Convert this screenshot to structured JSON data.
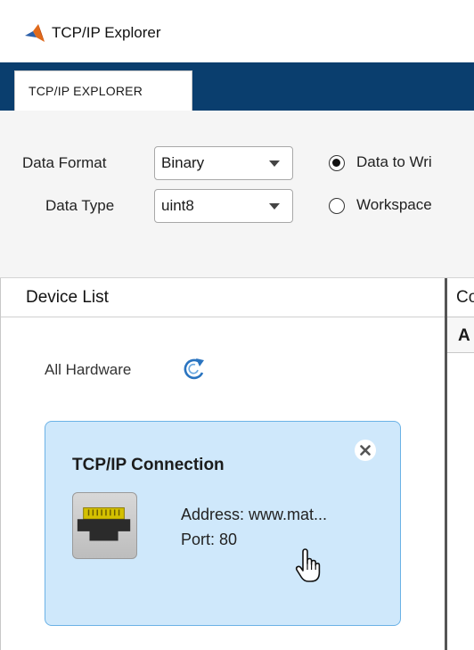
{
  "window": {
    "title": "TCP/IP Explorer",
    "logo_icon": "matlab-logo-icon"
  },
  "tabs": [
    {
      "label": "TCP/IP EXPLORER"
    }
  ],
  "toolstrip": {
    "data_format": {
      "label": "Data Format",
      "value": "Binary"
    },
    "data_type": {
      "label": "Data Type",
      "value": "uint8"
    },
    "radio_data_to_write": {
      "label": "Data to Wri",
      "selected": true
    },
    "radio_workspace": {
      "label": "Workspace",
      "selected": false
    }
  },
  "device_list": {
    "header": "Device List",
    "all_hardware_label": "All Hardware",
    "refresh_icon": "refresh-icon",
    "card": {
      "title": "TCP/IP Connection",
      "address": "Address: www.mat...",
      "port": "Port: 80",
      "icon": "ethernet-port-icon"
    }
  },
  "right_panel": {
    "header_fragment": "Co",
    "subheader_fragment": "A"
  },
  "colors": {
    "tab_strip": "#0a3e6e",
    "toolstrip_bg": "#f5f5f5",
    "card_bg": "#cfe8fb",
    "card_border": "#6bb2e6"
  }
}
